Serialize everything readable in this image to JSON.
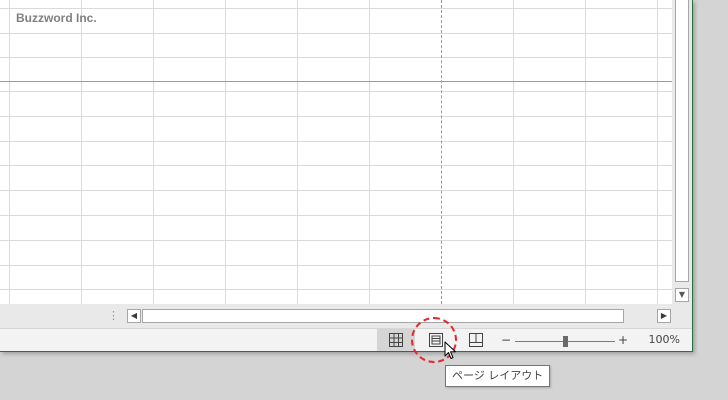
{
  "sheet": {
    "header_text": "Buzzword Inc."
  },
  "scrollbars": {
    "vertical_down_icon": "▼",
    "horizontal_left_icon": "◀",
    "horizontal_right_icon": "▶",
    "split_handle_icon": "⋮"
  },
  "status_bar": {
    "views": [
      {
        "name": "normal-view",
        "icon": "grid-icon",
        "active": false
      },
      {
        "name": "page-layout-view",
        "icon": "page-layout-icon",
        "active": true
      },
      {
        "name": "page-break-preview",
        "icon": "page-break-icon",
        "active": false
      }
    ],
    "zoom": {
      "minus_label": "−",
      "plus_label": "+",
      "level_text": "100%",
      "value_percent": 100
    }
  },
  "tooltip": {
    "text": "ページ レイアウト"
  },
  "colors": {
    "window_border": "#217346",
    "highlight_circle": "#e8282d",
    "active_view_bg": "#d5d5d5"
  }
}
